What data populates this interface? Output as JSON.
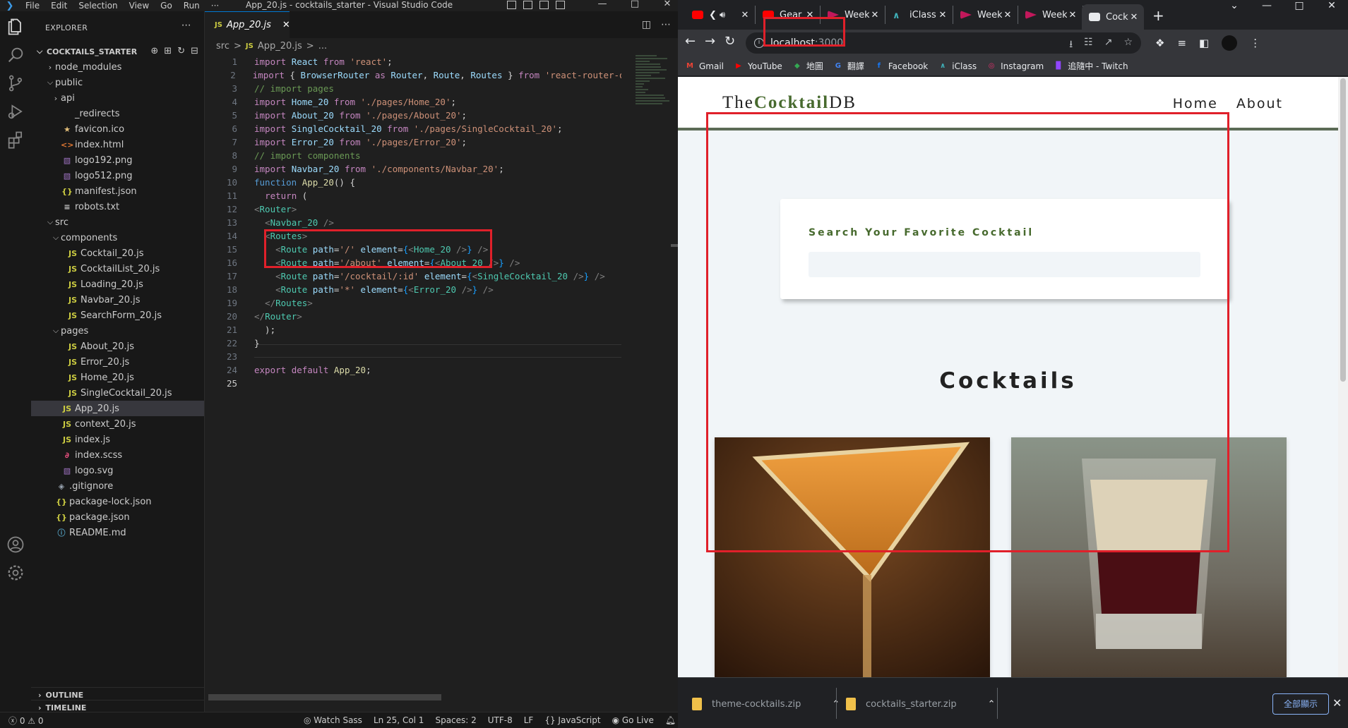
{
  "vscode": {
    "title_bar": {
      "menus": [
        "File",
        "Edit",
        "Selection",
        "View",
        "Go",
        "Run",
        "···"
      ],
      "window_title": "App_20.js - cocktails_starter - Visual Studio Code"
    },
    "explorer": {
      "header": "EXPLORER",
      "project": "COCKTAILS_STARTER",
      "tree": [
        {
          "label": "node_modules",
          "kind": "folder",
          "state": "collapsed",
          "depth": 0,
          "icon": ""
        },
        {
          "label": "public",
          "kind": "folder",
          "state": "expanded",
          "depth": 0,
          "icon": ""
        },
        {
          "label": "api",
          "kind": "folder",
          "state": "collapsed",
          "depth": 1,
          "icon": ""
        },
        {
          "label": "_redirects",
          "kind": "file",
          "depth": 1,
          "icon": "",
          "icon_class": "ic-txt"
        },
        {
          "label": "favicon.ico",
          "kind": "file",
          "depth": 1,
          "icon": "★",
          "icon_class": "ic-star"
        },
        {
          "label": "index.html",
          "kind": "file",
          "depth": 1,
          "icon": "<>",
          "icon_class": "ic-html"
        },
        {
          "label": "logo192.png",
          "kind": "file",
          "depth": 1,
          "icon": "▧",
          "icon_class": "ic-img"
        },
        {
          "label": "logo512.png",
          "kind": "file",
          "depth": 1,
          "icon": "▧",
          "icon_class": "ic-img"
        },
        {
          "label": "manifest.json",
          "kind": "file",
          "depth": 1,
          "icon": "{}",
          "icon_class": "ic-json"
        },
        {
          "label": "robots.txt",
          "kind": "file",
          "depth": 1,
          "icon": "≡",
          "icon_class": "ic-txt"
        },
        {
          "label": "src",
          "kind": "folder",
          "state": "expanded",
          "depth": 0,
          "icon": ""
        },
        {
          "label": "components",
          "kind": "folder",
          "state": "expanded",
          "depth": 1,
          "icon": ""
        },
        {
          "label": "Cocktail_20.js",
          "kind": "file",
          "depth": 2,
          "icon": "JS",
          "icon_class": "ic-js"
        },
        {
          "label": "CocktailList_20.js",
          "kind": "file",
          "depth": 2,
          "icon": "JS",
          "icon_class": "ic-js"
        },
        {
          "label": "Loading_20.js",
          "kind": "file",
          "depth": 2,
          "icon": "JS",
          "icon_class": "ic-js"
        },
        {
          "label": "Navbar_20.js",
          "kind": "file",
          "depth": 2,
          "icon": "JS",
          "icon_class": "ic-js"
        },
        {
          "label": "SearchForm_20.js",
          "kind": "file",
          "depth": 2,
          "icon": "JS",
          "icon_class": "ic-js"
        },
        {
          "label": "pages",
          "kind": "folder",
          "state": "expanded",
          "depth": 1,
          "icon": ""
        },
        {
          "label": "About_20.js",
          "kind": "file",
          "depth": 2,
          "icon": "JS",
          "icon_class": "ic-js"
        },
        {
          "label": "Error_20.js",
          "kind": "file",
          "depth": 2,
          "icon": "JS",
          "icon_class": "ic-js"
        },
        {
          "label": "Home_20.js",
          "kind": "file",
          "depth": 2,
          "icon": "JS",
          "icon_class": "ic-js"
        },
        {
          "label": "SingleCocktail_20.js",
          "kind": "file",
          "depth": 2,
          "icon": "JS",
          "icon_class": "ic-js"
        },
        {
          "label": "App_20.js",
          "kind": "file",
          "depth": 1,
          "icon": "JS",
          "icon_class": "ic-js",
          "active": true
        },
        {
          "label": "context_20.js",
          "kind": "file",
          "depth": 1,
          "icon": "JS",
          "icon_class": "ic-js"
        },
        {
          "label": "index.js",
          "kind": "file",
          "depth": 1,
          "icon": "JS",
          "icon_class": "ic-js"
        },
        {
          "label": "index.scss",
          "kind": "file",
          "depth": 1,
          "icon": "∂",
          "icon_class": "ic-scss"
        },
        {
          "label": "logo.svg",
          "kind": "file",
          "depth": 1,
          "icon": "▧",
          "icon_class": "ic-svg"
        },
        {
          "label": ".gitignore",
          "kind": "file",
          "depth": 0,
          "icon": "◈",
          "icon_class": "ic-git"
        },
        {
          "label": "package-lock.json",
          "kind": "file",
          "depth": 0,
          "icon": "{}",
          "icon_class": "ic-json"
        },
        {
          "label": "package.json",
          "kind": "file",
          "depth": 0,
          "icon": "{}",
          "icon_class": "ic-json"
        },
        {
          "label": "README.md",
          "kind": "file",
          "depth": 0,
          "icon": "ⓘ",
          "icon_class": "ic-info"
        }
      ],
      "outline": "OUTLINE",
      "timeline": "TIMELINE"
    },
    "editor": {
      "tab": {
        "label": "App_20.js",
        "icon": "JS"
      },
      "breadcrumb": [
        "src",
        ">",
        "JS",
        "App_20.js",
        ">",
        "..."
      ],
      "current_line": 25,
      "lines": [
        [
          [
            "kw",
            "import "
          ],
          [
            "var",
            "React "
          ],
          [
            "kw",
            "from "
          ],
          [
            "str",
            "'react'"
          ],
          [
            "",
            "; "
          ]
        ],
        [
          [
            "kw",
            "import "
          ],
          [
            "",
            "{ "
          ],
          [
            "var",
            "BrowserRouter "
          ],
          [
            "kw",
            "as "
          ],
          [
            "var",
            "Router"
          ],
          [
            ", "
          ],
          [
            "var",
            "Route"
          ],
          [
            "",
            ", "
          ],
          [
            "var",
            "Routes "
          ],
          [
            "",
            "} "
          ],
          [
            "kw",
            "from "
          ],
          [
            "str",
            "'react-router-dom'"
          ]
        ],
        [
          [
            "cm",
            "// import pages"
          ]
        ],
        [
          [
            "kw",
            "import "
          ],
          [
            "var",
            "Home_20 "
          ],
          [
            "kw",
            "from "
          ],
          [
            "str",
            "'./pages/Home_20'"
          ],
          [
            "",
            ";"
          ]
        ],
        [
          [
            "kw",
            "import "
          ],
          [
            "var",
            "About_20 "
          ],
          [
            "kw",
            "from "
          ],
          [
            "str",
            "'./pages/About_20'"
          ],
          [
            "",
            ";"
          ]
        ],
        [
          [
            "kw",
            "import "
          ],
          [
            "var",
            "SingleCocktail_20 "
          ],
          [
            "kw",
            "from "
          ],
          [
            "str",
            "'./pages/SingleCocktail_20'"
          ],
          [
            "",
            ";"
          ]
        ],
        [
          [
            "kw",
            "import "
          ],
          [
            "var",
            "Error_20 "
          ],
          [
            "kw",
            "from "
          ],
          [
            "str",
            "'./pages/Error_20'"
          ],
          [
            "",
            ";"
          ]
        ],
        [
          [
            "cm",
            "// import components"
          ]
        ],
        [
          [
            "kw",
            "import "
          ],
          [
            "var",
            "Navbar_20 "
          ],
          [
            "kw",
            "from "
          ],
          [
            "str",
            "'./components/Navbar_20'"
          ],
          [
            "",
            ";"
          ]
        ],
        [
          [
            "kw2",
            "function "
          ],
          [
            "fn",
            "App_20"
          ],
          [
            "",
            "() {"
          ]
        ],
        [
          [
            "",
            "  "
          ],
          [
            "kw",
            "return "
          ],
          [
            "",
            "("
          ]
        ],
        [
          [
            "tagd",
            "<"
          ],
          [
            "tag",
            "Router"
          ],
          [
            "tagd",
            ">"
          ]
        ],
        [
          [
            "",
            "  "
          ],
          [
            "tagd",
            "<"
          ],
          [
            "tag",
            "Navbar_20 "
          ],
          [
            "tagd",
            "/>"
          ]
        ],
        [
          [
            "",
            "  "
          ],
          [
            "tagd",
            "<"
          ],
          [
            "tag",
            "Routes"
          ],
          [
            "tagd",
            ">"
          ]
        ],
        [
          [
            "",
            "    "
          ],
          [
            "tagd",
            "<"
          ],
          [
            "tag",
            "Route "
          ],
          [
            "var",
            "path"
          ],
          [
            "",
            "="
          ],
          [
            "str",
            "'/' "
          ],
          [
            "var",
            "element"
          ],
          [
            "",
            "="
          ],
          [
            "brk2",
            "{"
          ],
          [
            "tagd",
            "<"
          ],
          [
            "tag",
            "Home_20 "
          ],
          [
            "tagd",
            "/>"
          ],
          [
            "brk2",
            "}"
          ],
          [
            "tagd",
            " />"
          ]
        ],
        [
          [
            "",
            "    "
          ],
          [
            "tagd",
            "<"
          ],
          [
            "tag",
            "Route "
          ],
          [
            "var",
            "path"
          ],
          [
            "",
            "="
          ],
          [
            "str",
            "'/about' "
          ],
          [
            "var",
            "element"
          ],
          [
            "",
            "="
          ],
          [
            "brk2",
            "{"
          ],
          [
            "tagd",
            "<"
          ],
          [
            "tag",
            "About_20 "
          ],
          [
            "tagd",
            "/>"
          ],
          [
            "brk2",
            "}"
          ],
          [
            "tagd",
            " />"
          ]
        ],
        [
          [
            "",
            "    "
          ],
          [
            "tagd",
            "<"
          ],
          [
            "tag",
            "Route "
          ],
          [
            "var",
            "path"
          ],
          [
            "",
            "="
          ],
          [
            "str",
            "'/cocktail/:id' "
          ],
          [
            "var",
            "element"
          ],
          [
            "",
            "="
          ],
          [
            "brk2",
            "{"
          ],
          [
            "tagd",
            "<"
          ],
          [
            "tag",
            "SingleCocktail_20 "
          ],
          [
            "tagd",
            "/>"
          ],
          [
            "brk2",
            "}"
          ],
          [
            "tagd",
            " />"
          ]
        ],
        [
          [
            "",
            "    "
          ],
          [
            "tagd",
            "<"
          ],
          [
            "tag",
            "Route "
          ],
          [
            "var",
            "path"
          ],
          [
            "",
            "="
          ],
          [
            "str",
            "'*' "
          ],
          [
            "var",
            "element"
          ],
          [
            "",
            "="
          ],
          [
            "brk2",
            "{"
          ],
          [
            "tagd",
            "<"
          ],
          [
            "tag",
            "Error_20 "
          ],
          [
            "tagd",
            "/>"
          ],
          [
            "brk2",
            "}"
          ],
          [
            "tagd",
            " />"
          ]
        ],
        [
          [
            "",
            "  "
          ],
          [
            "tagd",
            "</"
          ],
          [
            "tag",
            "Routes"
          ],
          [
            "tagd",
            ">"
          ]
        ],
        [
          [
            "tagd",
            "</"
          ],
          [
            "tag",
            "Router"
          ],
          [
            "tagd",
            ">"
          ]
        ],
        [
          [
            "",
            "  );"
          ]
        ],
        [
          [
            "",
            "}"
          ]
        ],
        [
          [
            "",
            ""
          ]
        ],
        [
          [
            "kw",
            "export "
          ],
          [
            "kw",
            "default "
          ],
          [
            "fn",
            "App_20"
          ],
          [
            "",
            ";"
          ]
        ],
        [
          [
            "",
            ""
          ]
        ]
      ]
    },
    "status_bar": {
      "problems": "ⓧ 0 ⚠ 0",
      "items": [
        "◎ Watch Sass",
        "Ln 25, Col 1",
        "Spaces: 2",
        "UTF-8",
        "LF",
        "{} JavaScript",
        "◉ Go Live"
      ]
    }
  },
  "chrome": {
    "tabs": [
      {
        "title": "",
        "favicon": "youtube",
        "active": false
      },
      {
        "title": "Gear",
        "favicon": "youtube",
        "active": false
      },
      {
        "title": "Week",
        "favicon": "red-play",
        "active": false
      },
      {
        "title": "iClass",
        "favicon": "iclass",
        "active": false
      },
      {
        "title": "Week",
        "favicon": "red-play",
        "active": false
      },
      {
        "title": "Week",
        "favicon": "red-play",
        "active": false
      },
      {
        "title": "Cockt",
        "favicon": "globe",
        "active": true
      }
    ],
    "address": {
      "host": "localhost",
      "port": ":3000"
    },
    "bookmarks": [
      {
        "label": "Gmail",
        "icon": "M",
        "color": "#ea4335"
      },
      {
        "label": "YouTube",
        "icon": "▶",
        "color": "#ff0000"
      },
      {
        "label": "地圖",
        "icon": "◆",
        "color": "#34a853"
      },
      {
        "label": "翻譯",
        "icon": "G",
        "color": "#4285f4"
      },
      {
        "label": "Facebook",
        "icon": "f",
        "color": "#1877f2"
      },
      {
        "label": "iClass",
        "icon": "∧",
        "color": "#3fb0b8"
      },
      {
        "label": "Instagram",
        "icon": "◎",
        "color": "#e1306c"
      },
      {
        "label": "追隨中 - Twitch",
        "icon": "▉",
        "color": "#9146ff"
      }
    ],
    "page": {
      "logo": {
        "prefix": "The",
        "bold": "Cocktail",
        "suffix": "DB"
      },
      "nav_links": [
        "Home",
        "About"
      ],
      "search_label": "Search Your Favorite Cocktail",
      "search_value": "",
      "section_title": "Cocktails"
    },
    "downloads": {
      "items": [
        "theme-cocktails.zip",
        "cocktails_starter.zip"
      ],
      "show_all": "全部顯示"
    }
  },
  "colors": {
    "accent_green": "#476a2e",
    "highlight_red": "#e0202a",
    "vscode_bg": "#1e1e1e",
    "page_bg": "#f1f5f8"
  }
}
